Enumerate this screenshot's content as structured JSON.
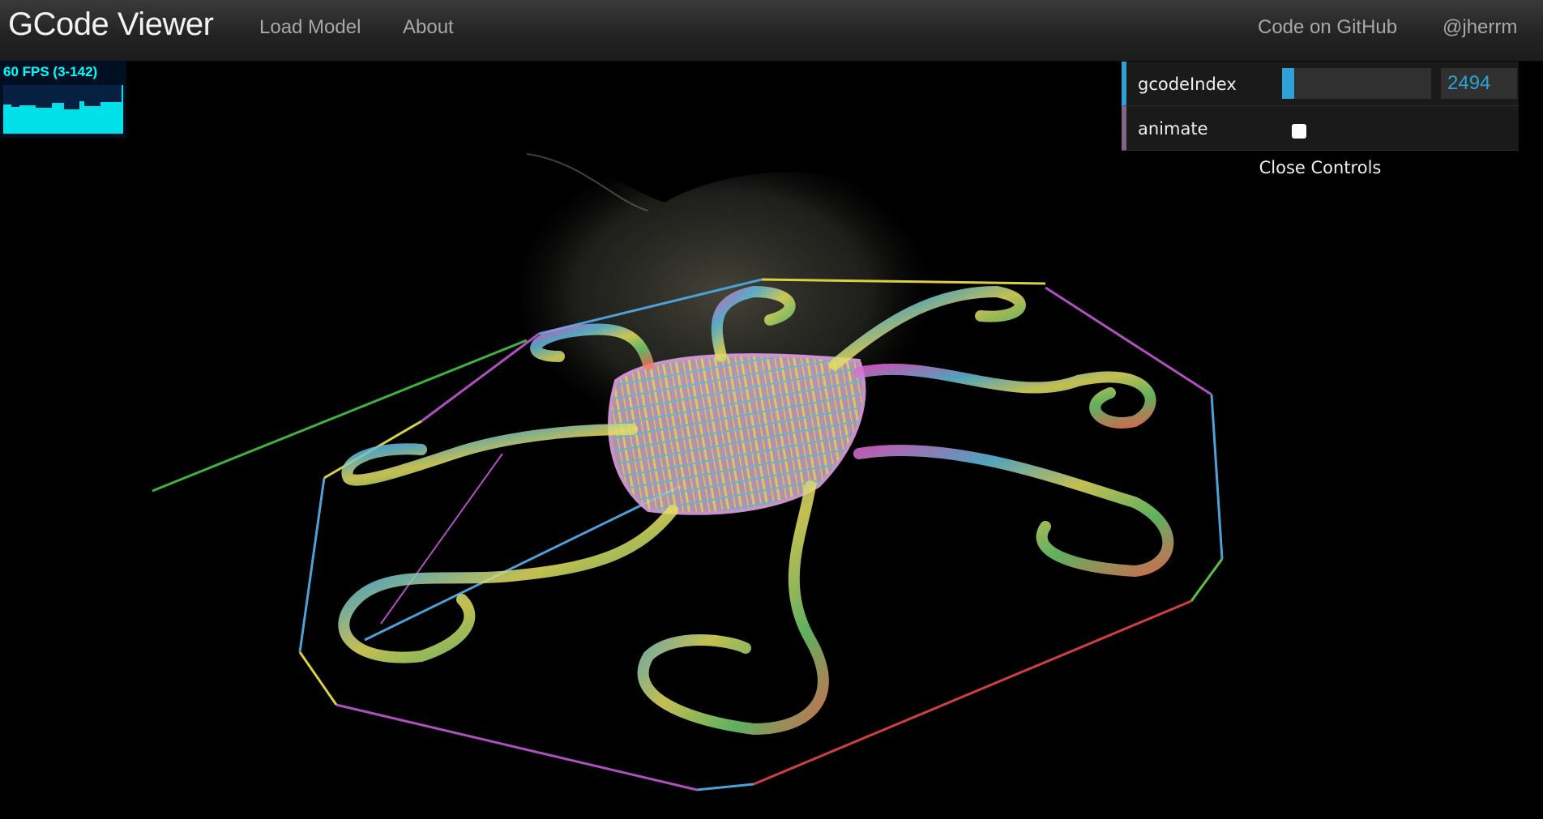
{
  "navbar": {
    "brand": "GCode Viewer",
    "links": [
      "Load Model",
      "About"
    ],
    "right_links": [
      "Code on GitHub",
      "@jherrm"
    ]
  },
  "stats": {
    "fps_text": "60 FPS (3-142)",
    "color": "#00ffff"
  },
  "controls": {
    "gcode_index_label": "gcodeIndex",
    "gcode_index_value": "2494",
    "gcode_index_fill": 0.08,
    "animate_label": "animate",
    "animate_checked": false,
    "close_label": "Close Controls",
    "accent_color": "#2fa1d6"
  },
  "icons": [
    "checkbox-icon"
  ]
}
